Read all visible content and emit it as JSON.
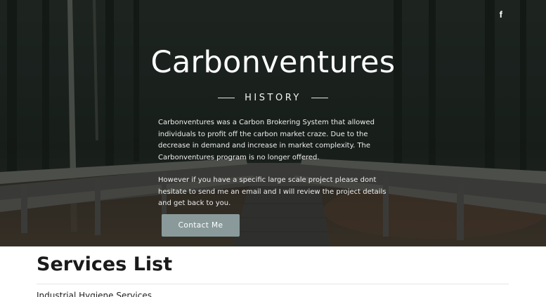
{
  "hero": {
    "title": "Carbonventures",
    "section_heading": "HISTORY",
    "paragraph_1": "Carbonventures was a Carbon Brokering System that allowed individuals to profit off the carbon market craze. Due to the decrease in demand and increase in market complexity. The Carbonventures program is no longer offered.",
    "paragraph_2": "However if you have a specific large scale project please dont hesitate to send me an email and I will review the project details and get back to you.",
    "contact_button": "Contact Me",
    "social_icon": "facebook-icon",
    "social_label": "f"
  },
  "services": {
    "title": "Services List",
    "items": [
      "Industrial Hygiene Services"
    ]
  },
  "colors": {
    "button_bg": "#8a9a9b",
    "hero_text": "#ffffff",
    "page_bg": "#ffffff"
  }
}
